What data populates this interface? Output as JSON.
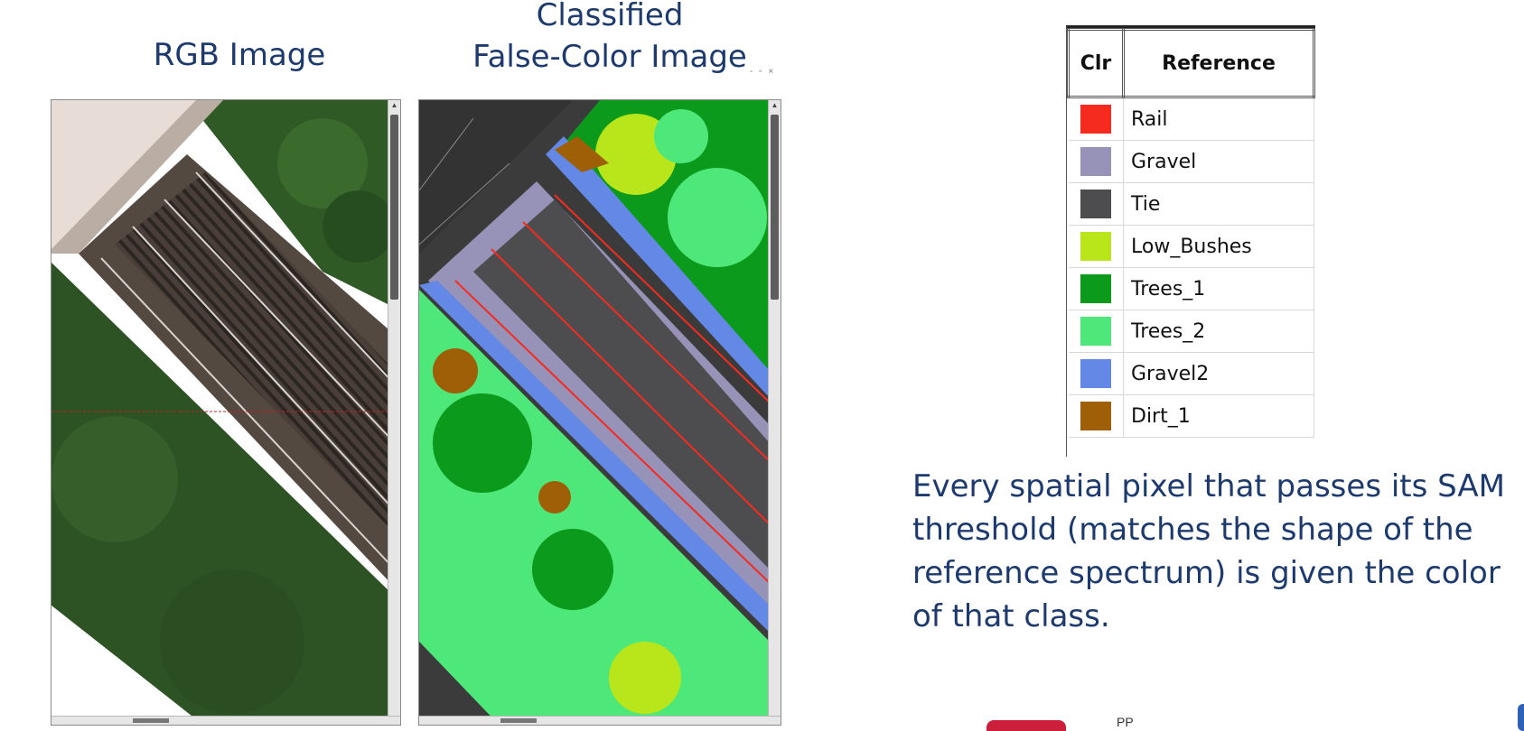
{
  "headings": {
    "rgb": "RGB Image",
    "classified_line1": "Classified",
    "classified_line2": "False-Color Image"
  },
  "legend": {
    "col_color": "Clr",
    "col_reference": "Reference",
    "rows": [
      {
        "name": "Rail",
        "color": "#f52b1f"
      },
      {
        "name": "Gravel",
        "color": "#9692b8"
      },
      {
        "name": "Tie",
        "color": "#4d4d4f"
      },
      {
        "name": "Low_Bushes",
        "color": "#b9e61a"
      },
      {
        "name": "Trees_1",
        "color": "#0b9a1c"
      },
      {
        "name": "Trees_2",
        "color": "#4ee87a"
      },
      {
        "name": "Gravel2",
        "color": "#6488e6"
      },
      {
        "name": "Dirt_1",
        "color": "#9e5f06"
      }
    ]
  },
  "caption": "Every spatial pixel that passes its SAM threshold (matches the shape of the reference spectrum) is given the color of that class.",
  "bottom_partial_text": "PP",
  "colors": {
    "heading_text": "#1c3a6e",
    "rgb_foliage": "#2f5a26",
    "rgb_track": "#4a3f38",
    "class_background": "#3b3b3b"
  }
}
